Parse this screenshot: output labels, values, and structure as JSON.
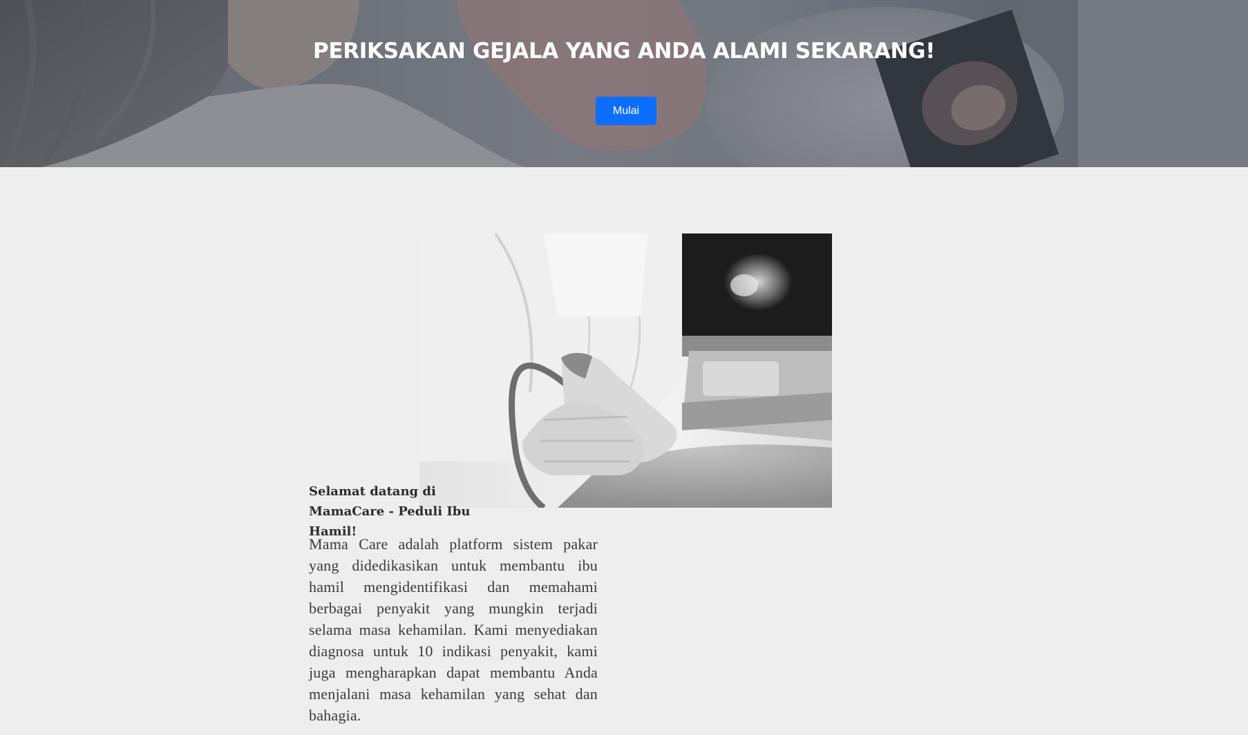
{
  "hero": {
    "title": "PERIKSAKAN GEJALA YANG ANDA ALAMI SEKARANG!",
    "button_label": "Mulai",
    "button_color": "#0d6efd"
  },
  "intro": {
    "image_alt": "ultrasound examination photo",
    "heading": "Selamat datang di MamaCare - Peduli Ibu Hamil!",
    "body": "Mama Care adalah platform sistem pakar yang didedikasikan untuk membantu ibu hamil mengidentifikasi dan memahami berbagai penyakit yang mungkin terjadi selama masa kehamilan. Kami menyediakan diagnosa untuk 10 indikasi penyakit, kami juga mengharapkan dapat membantu Anda menjalani masa kehamilan yang sehat dan bahagia."
  },
  "colors": {
    "page_background": "#edeeed",
    "text": "#3a3a3a"
  }
}
